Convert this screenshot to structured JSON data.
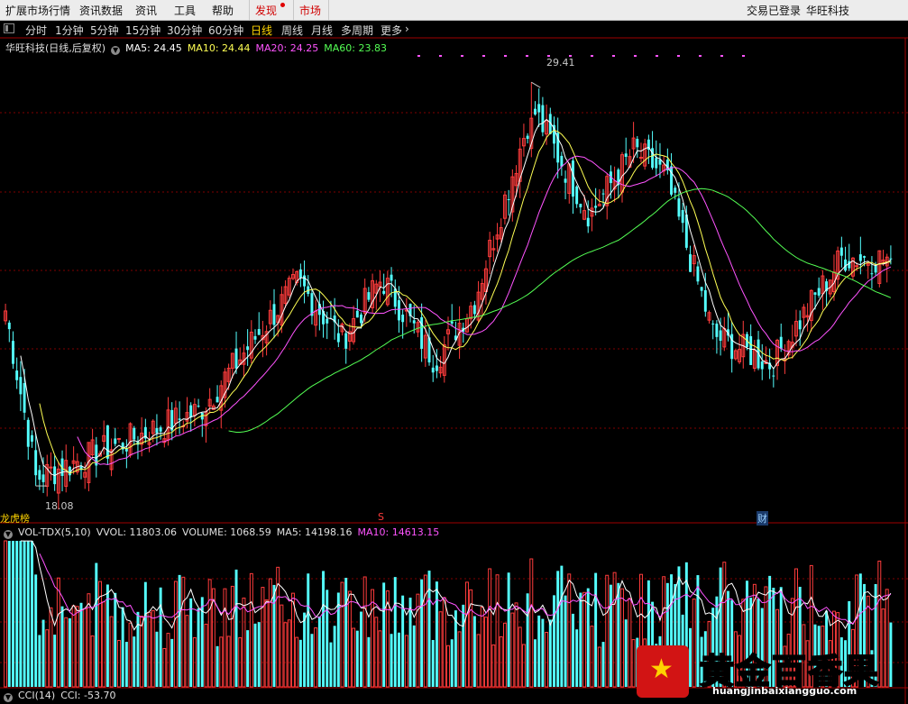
{
  "menu": {
    "items": [
      "扩展市场行情",
      "资讯数据",
      "资讯",
      "工具",
      "帮助"
    ],
    "discover": "发现",
    "market": "市场",
    "login_status": "交易已登录",
    "stock_name": "华旺科技"
  },
  "periods": [
    "分时",
    "1分钟",
    "5分钟",
    "15分钟",
    "30分钟",
    "60分钟",
    "日线",
    "周线",
    "月线",
    "多周期",
    "更多"
  ],
  "main_legend": {
    "title": "华旺科技(日线,后复权)",
    "ma5": "MA5: 24.45",
    "ma10": "MA10: 24.44",
    "ma20": "MA20: 24.25",
    "ma60": "MA60: 23.83"
  },
  "price_labels": {
    "high": "29.41",
    "low": "18.08"
  },
  "markers": {
    "left": "龙虎榜",
    "s": "S",
    "cai": "财"
  },
  "vol_legend": {
    "name": "VOL-TDX(5,10)",
    "vvol": "VVOL: 11803.06",
    "volume": "VOLUME: 1068.59",
    "ma5": "MA5: 14198.16",
    "ma10": "MA10: 14613.15"
  },
  "cci_legend": {
    "name": "CCI(14)",
    "cci": "CCI: -53.70"
  },
  "watermark": {
    "title": "黄金百香果",
    "url": "huangjinbaixiangguo.com"
  },
  "colors": {
    "up": "#ff3c3c",
    "down": "#54ffff",
    "ma5": "#ffffff",
    "ma10": "#ffff54",
    "ma20": "#ff54ff",
    "ma60": "#54ff54",
    "grid": "#800000"
  },
  "chart_data": {
    "type": "candlestick",
    "symbol": "华旺科技",
    "period": "日线",
    "high": 29.41,
    "low": 18.08,
    "ylim": [
      17.5,
      30.2
    ],
    "key_points": [
      {
        "x": 0.0,
        "close": 23.0
      },
      {
        "x": 0.035,
        "close": 18.3
      },
      {
        "x": 0.22,
        "close": 20.2
      },
      {
        "x": 0.33,
        "close": 23.8
      },
      {
        "x": 0.38,
        "close": 22.2
      },
      {
        "x": 0.425,
        "close": 23.9
      },
      {
        "x": 0.485,
        "close": 21.6
      },
      {
        "x": 0.53,
        "close": 23.3
      },
      {
        "x": 0.595,
        "close": 28.7
      },
      {
        "x": 0.66,
        "close": 25.7
      },
      {
        "x": 0.71,
        "close": 27.5
      },
      {
        "x": 0.745,
        "close": 26.8
      },
      {
        "x": 0.8,
        "close": 22.3
      },
      {
        "x": 0.865,
        "close": 21.5
      },
      {
        "x": 0.945,
        "close": 24.5
      },
      {
        "x": 1.0,
        "close": 24.45
      }
    ],
    "ma_final": {
      "MA5": 24.45,
      "MA10": 24.44,
      "MA20": 24.25,
      "MA60": 23.83
    }
  }
}
